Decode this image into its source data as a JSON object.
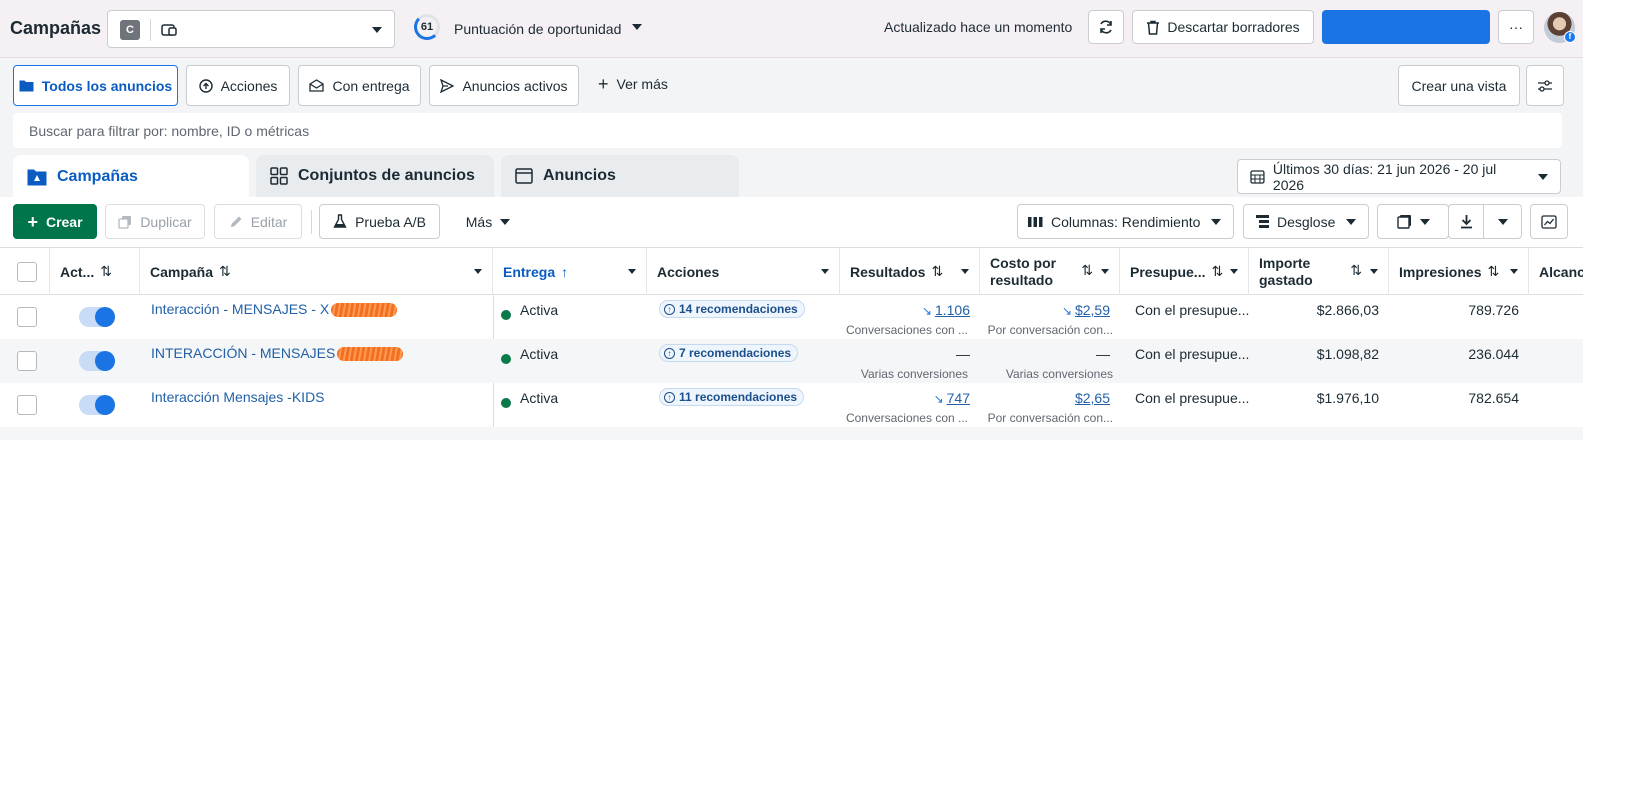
{
  "topbar": {
    "title": "Campañas",
    "account_badge": "C",
    "opportunity_score": "61",
    "opportunity_label": "Puntuación de oportunidad",
    "updated_text": "Actualizado hace un momento",
    "discard_label": "Descartar borradores",
    "more_label": "···",
    "fb_badge": "f"
  },
  "filters": {
    "chips": [
      {
        "label": "Todos los anuncios"
      },
      {
        "label": "Acciones"
      },
      {
        "label": "Con entrega"
      },
      {
        "label": "Anuncios activos"
      }
    ],
    "see_more": "Ver más",
    "create_view": "Crear una vista"
  },
  "search": {
    "placeholder": "Buscar para filtrar por: nombre, ID o métricas"
  },
  "tabs": [
    {
      "label": "Campañas"
    },
    {
      "label": "Conjuntos de anuncios"
    },
    {
      "label": "Anuncios"
    }
  ],
  "date_range": "Últimos 30 días: 21 jun 2026 - 20 jul 2026",
  "toolbar": {
    "create": "Crear",
    "duplicate": "Duplicar",
    "edit": "Editar",
    "abtest": "Prueba A/B",
    "more": "Más",
    "columns": "Columnas: Rendimiento",
    "breakdown": "Desglose"
  },
  "table": {
    "headers": {
      "active": "Act...",
      "campaign": "Campaña",
      "delivery": "Entrega",
      "actions": "Acciones",
      "results": "Resultados",
      "cost_line1": "Costo por",
      "cost_line2": "resultado",
      "budget": "Presupue...",
      "spent_line1": "Importe",
      "spent_line2": "gastado",
      "impressions": "Impresiones",
      "reach": "Alcance"
    },
    "sort_glyph": "⇅",
    "up_glyph": "↑",
    "rows": [
      {
        "campaign": "Interacción - MENSAJES - X",
        "delivery": "Activa",
        "recs": "14 recomendaciones",
        "results": "1.106",
        "results_sub": "Conversaciones con ...",
        "cost": "$2,59",
        "cost_sub": "Por conversación con...",
        "budget": "Con el presupue...",
        "spent": "$2.866,03",
        "impressions": "789.726"
      },
      {
        "campaign": "INTERACCIÓN - MENSAJES",
        "delivery": "Activa",
        "recs": "7 recomendaciones",
        "results": "—",
        "results_sub": "Varias conversiones",
        "cost": "—",
        "cost_sub": "Varias conversiones",
        "budget": "Con el presupue...",
        "spent": "$1.098,82",
        "impressions": "236.044"
      },
      {
        "campaign": "Interacción Mensajes -KIDS",
        "delivery": "Activa",
        "recs": "11 recomendaciones",
        "results": "747",
        "results_sub": "Conversaciones con ...",
        "cost": "$2,65",
        "cost_sub": "Por conversación con...",
        "budget": "Con el presupue...",
        "spent": "$1.976,10",
        "impressions": "782.654"
      }
    ]
  },
  "colors": {
    "accent": "#1b74e4",
    "create_green": "#00754a",
    "active_status": "#0b7a4b",
    "link": "#2260a8"
  }
}
